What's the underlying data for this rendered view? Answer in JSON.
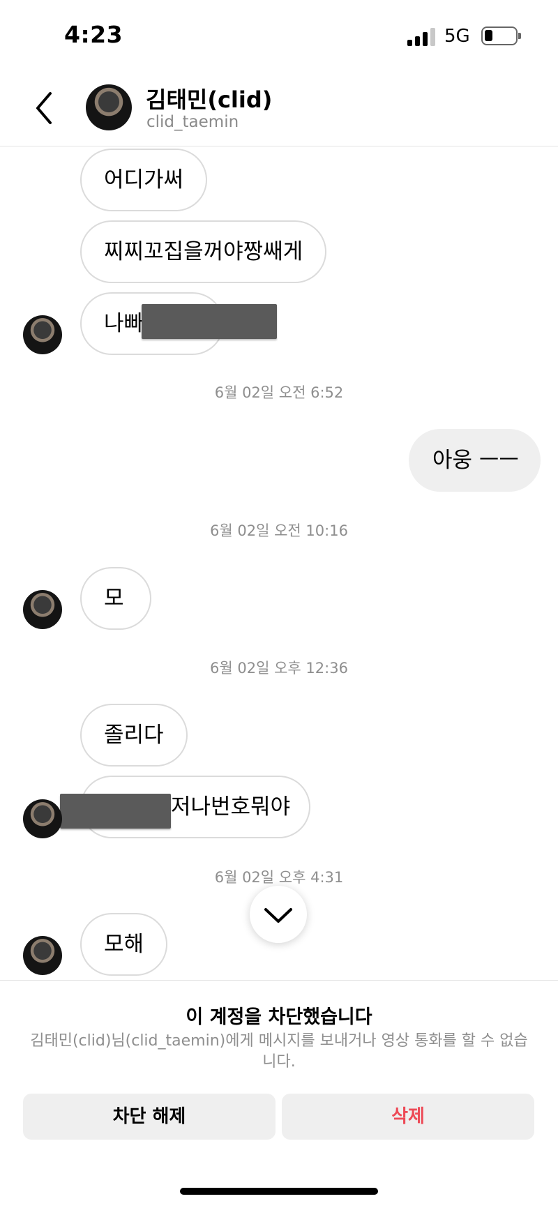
{
  "status_bar": {
    "time": "4:23",
    "network": "5G"
  },
  "header": {
    "name": "김태민(clid)",
    "username": "clid_taemin"
  },
  "messages": {
    "m1": "어디가써",
    "m2": "찌찌꼬집을꺼야짱쌔게",
    "m3": "나빠",
    "t1": "6월 02일 오전 6:52",
    "m4": "아웅 ㅡㅡ",
    "t2": "6월 02일 오전 10:16",
    "m5": "모",
    "t3": "6월 02일 오후 12:36",
    "m6": "졸리다",
    "m7": "저나번호뭐야",
    "t4": "6월 02일 오후 4:31",
    "m8": "모해"
  },
  "blocked": {
    "title": "이 계정을 차단했습니다",
    "description": "김태민(clid)님(clid_taemin)에게 메시지를 보내거나 영상 통화를 할 수 없습니다.",
    "unblock_label": "차단 해제",
    "delete_label": "삭제"
  },
  "colors": {
    "delete": "#ed4956",
    "bubble_border": "#dbdbdb",
    "my_bubble": "#efefef",
    "muted_text": "#8e8e8e"
  },
  "icons": [
    "signal-icon",
    "battery-icon",
    "back-arrow-icon",
    "chevron-down-icon"
  ]
}
